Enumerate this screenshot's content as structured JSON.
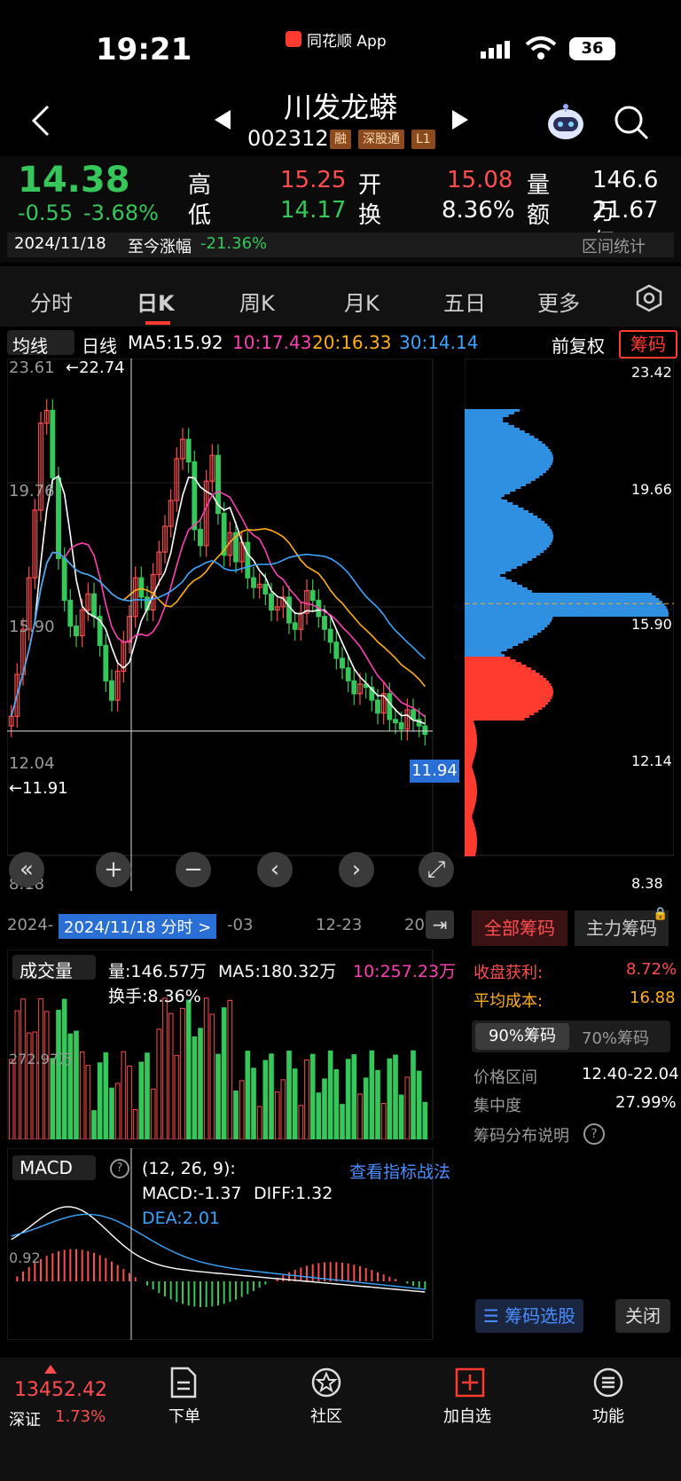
{
  "status": {
    "time": "19:21",
    "app_name": "同花顺 App",
    "battery": "36"
  },
  "header": {
    "title": "川发龙蟒",
    "code": "002312",
    "tags": [
      "融",
      "深股通",
      "L1"
    ]
  },
  "quote": {
    "price": "14.38",
    "change": "-0.55",
    "change_pct": "-3.68%",
    "high_label": "高",
    "high": "15.25",
    "open_label": "开",
    "open": "15.08",
    "vol_label": "量",
    "vol": "146.6万",
    "low_label": "低",
    "low": "14.17",
    "turnover_label": "换",
    "turnover": "8.36%",
    "amount_label": "额",
    "amount": "21.67亿",
    "date": "2024/11/18",
    "since_label": "至今涨幅",
    "since_value": "-21.36%",
    "range_stats": "区间统计"
  },
  "tabs": [
    "分时",
    "日K",
    "周K",
    "月K",
    "五日",
    "更多"
  ],
  "kline": {
    "ma_selector": "均线",
    "period": "日线",
    "ma5": "MA5:15.92",
    "ma10": "10:17.43",
    "ma20": "20:16.33",
    "ma30": "30:14.14",
    "adjust": "前复权",
    "chips_btn": "筹码",
    "y_labels": [
      "23.61",
      "19.76",
      "15.90",
      "12.04",
      "8.18"
    ],
    "max_mark": "22.74",
    "min_mark": "11.91",
    "last_price_tag": "11.94",
    "x_labels": [
      "2024-",
      "-03",
      "12-23",
      "20"
    ],
    "crosshair_label": "2024/11/18 分时 >"
  },
  "chips": {
    "y_labels": [
      "23.42",
      "19.66",
      "15.90",
      "12.14",
      "8.38"
    ],
    "tab_all": "全部筹码",
    "tab_main": "主力筹码",
    "profit_label": "收盘获利:",
    "profit": "8.72%",
    "avg_label": "平均成本:",
    "avg": "16.88",
    "btn90": "90%筹码",
    "btn70": "70%筹码",
    "range_label": "价格区间",
    "range": "12.40-22.04",
    "conc_label": "集中度",
    "conc": "27.99%",
    "help_label": "筹码分布说明",
    "select_btn": "筹码选股",
    "close_btn": "关闭"
  },
  "volume": {
    "selector": "成交量",
    "vol": "量:146.57万",
    "ma5": "MA5:180.32万",
    "ma10": "10:257.23万",
    "turnover": "换手:8.36%",
    "axis": "272.97万"
  },
  "macd": {
    "selector": "MACD",
    "params": "(12, 26, 9):",
    "link": "查看指标战法",
    "macd": "MACD:-1.37",
    "diff": "DIFF:1.32",
    "dea": "DEA:2.01",
    "axis": "0.92"
  },
  "bottom": {
    "index_value": "13452.42",
    "index_name": "深证",
    "index_pct": "1.73%",
    "items": [
      "下单",
      "社区",
      "加自选",
      "功能"
    ]
  },
  "chart_data": {
    "type": "candlestick",
    "y_range": [
      8.18,
      23.61
    ],
    "closes": [
      12.5,
      13.8,
      15.2,
      16.8,
      18.9,
      21.6,
      22.0,
      19.9,
      17.4,
      16.1,
      15.3,
      15.0,
      15.8,
      16.3,
      15.6,
      14.7,
      13.6,
      13.0,
      13.9,
      14.8,
      15.6,
      16.8,
      16.2,
      15.8,
      16.9,
      17.6,
      18.4,
      19.2,
      20.5,
      21.1,
      20.4,
      18.3,
      17.8,
      19.8,
      20.6,
      18.8,
      17.5,
      18.2,
      17.3,
      17.9,
      16.8,
      16.5,
      16.6,
      16.3,
      15.8,
      15.9,
      16.2,
      15.4,
      15.2,
      15.7,
      16.4,
      16.1,
      15.6,
      15.2,
      14.8,
      14.3,
      14.0,
      13.6,
      13.2,
      13.5,
      13.4,
      13.0,
      12.6,
      13.2,
      12.4,
      12.3,
      12.1,
      12.7,
      12.4,
      12.2,
      11.94
    ]
  }
}
